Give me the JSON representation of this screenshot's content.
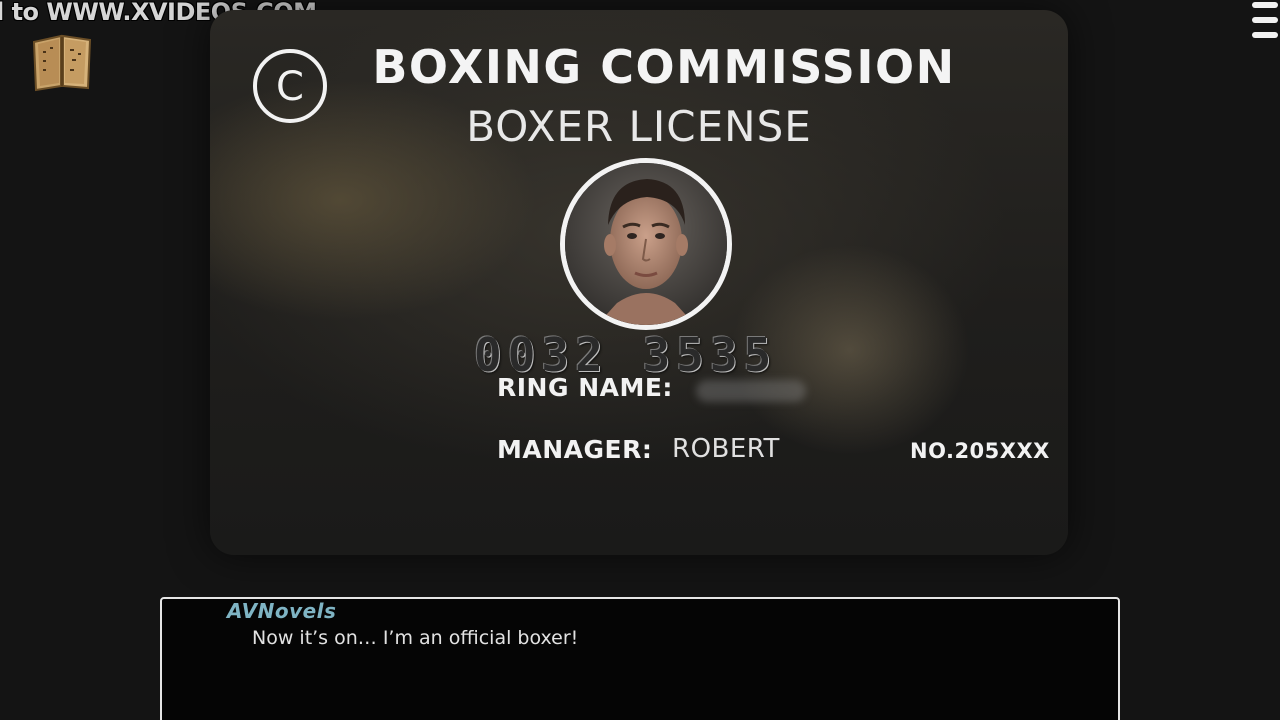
{
  "watermark": {
    "text": "l to WWW.XVIDEOS.COM"
  },
  "license_card": {
    "title": "BOXING COMMISSION",
    "subtitle": "BOXER LICENSE",
    "logo_symbol": "C",
    "card_number": "0032 3535",
    "ring_name_label": "RING NAME:",
    "ring_name_value": "",
    "manager_label": "MANAGER:",
    "manager_value": "ROBERT",
    "license_number": "NO.205XXX"
  },
  "dialogue": {
    "speaker": "AVNovels",
    "text": "Now it’s on… I’m an official boxer!"
  },
  "colors": {
    "speaker_name": "#7fb4c4",
    "card_text": "#f2f2f2",
    "background": "#141414"
  },
  "icons": {
    "journal": "open-book-icon",
    "menu": "hamburger-menu-icon"
  }
}
